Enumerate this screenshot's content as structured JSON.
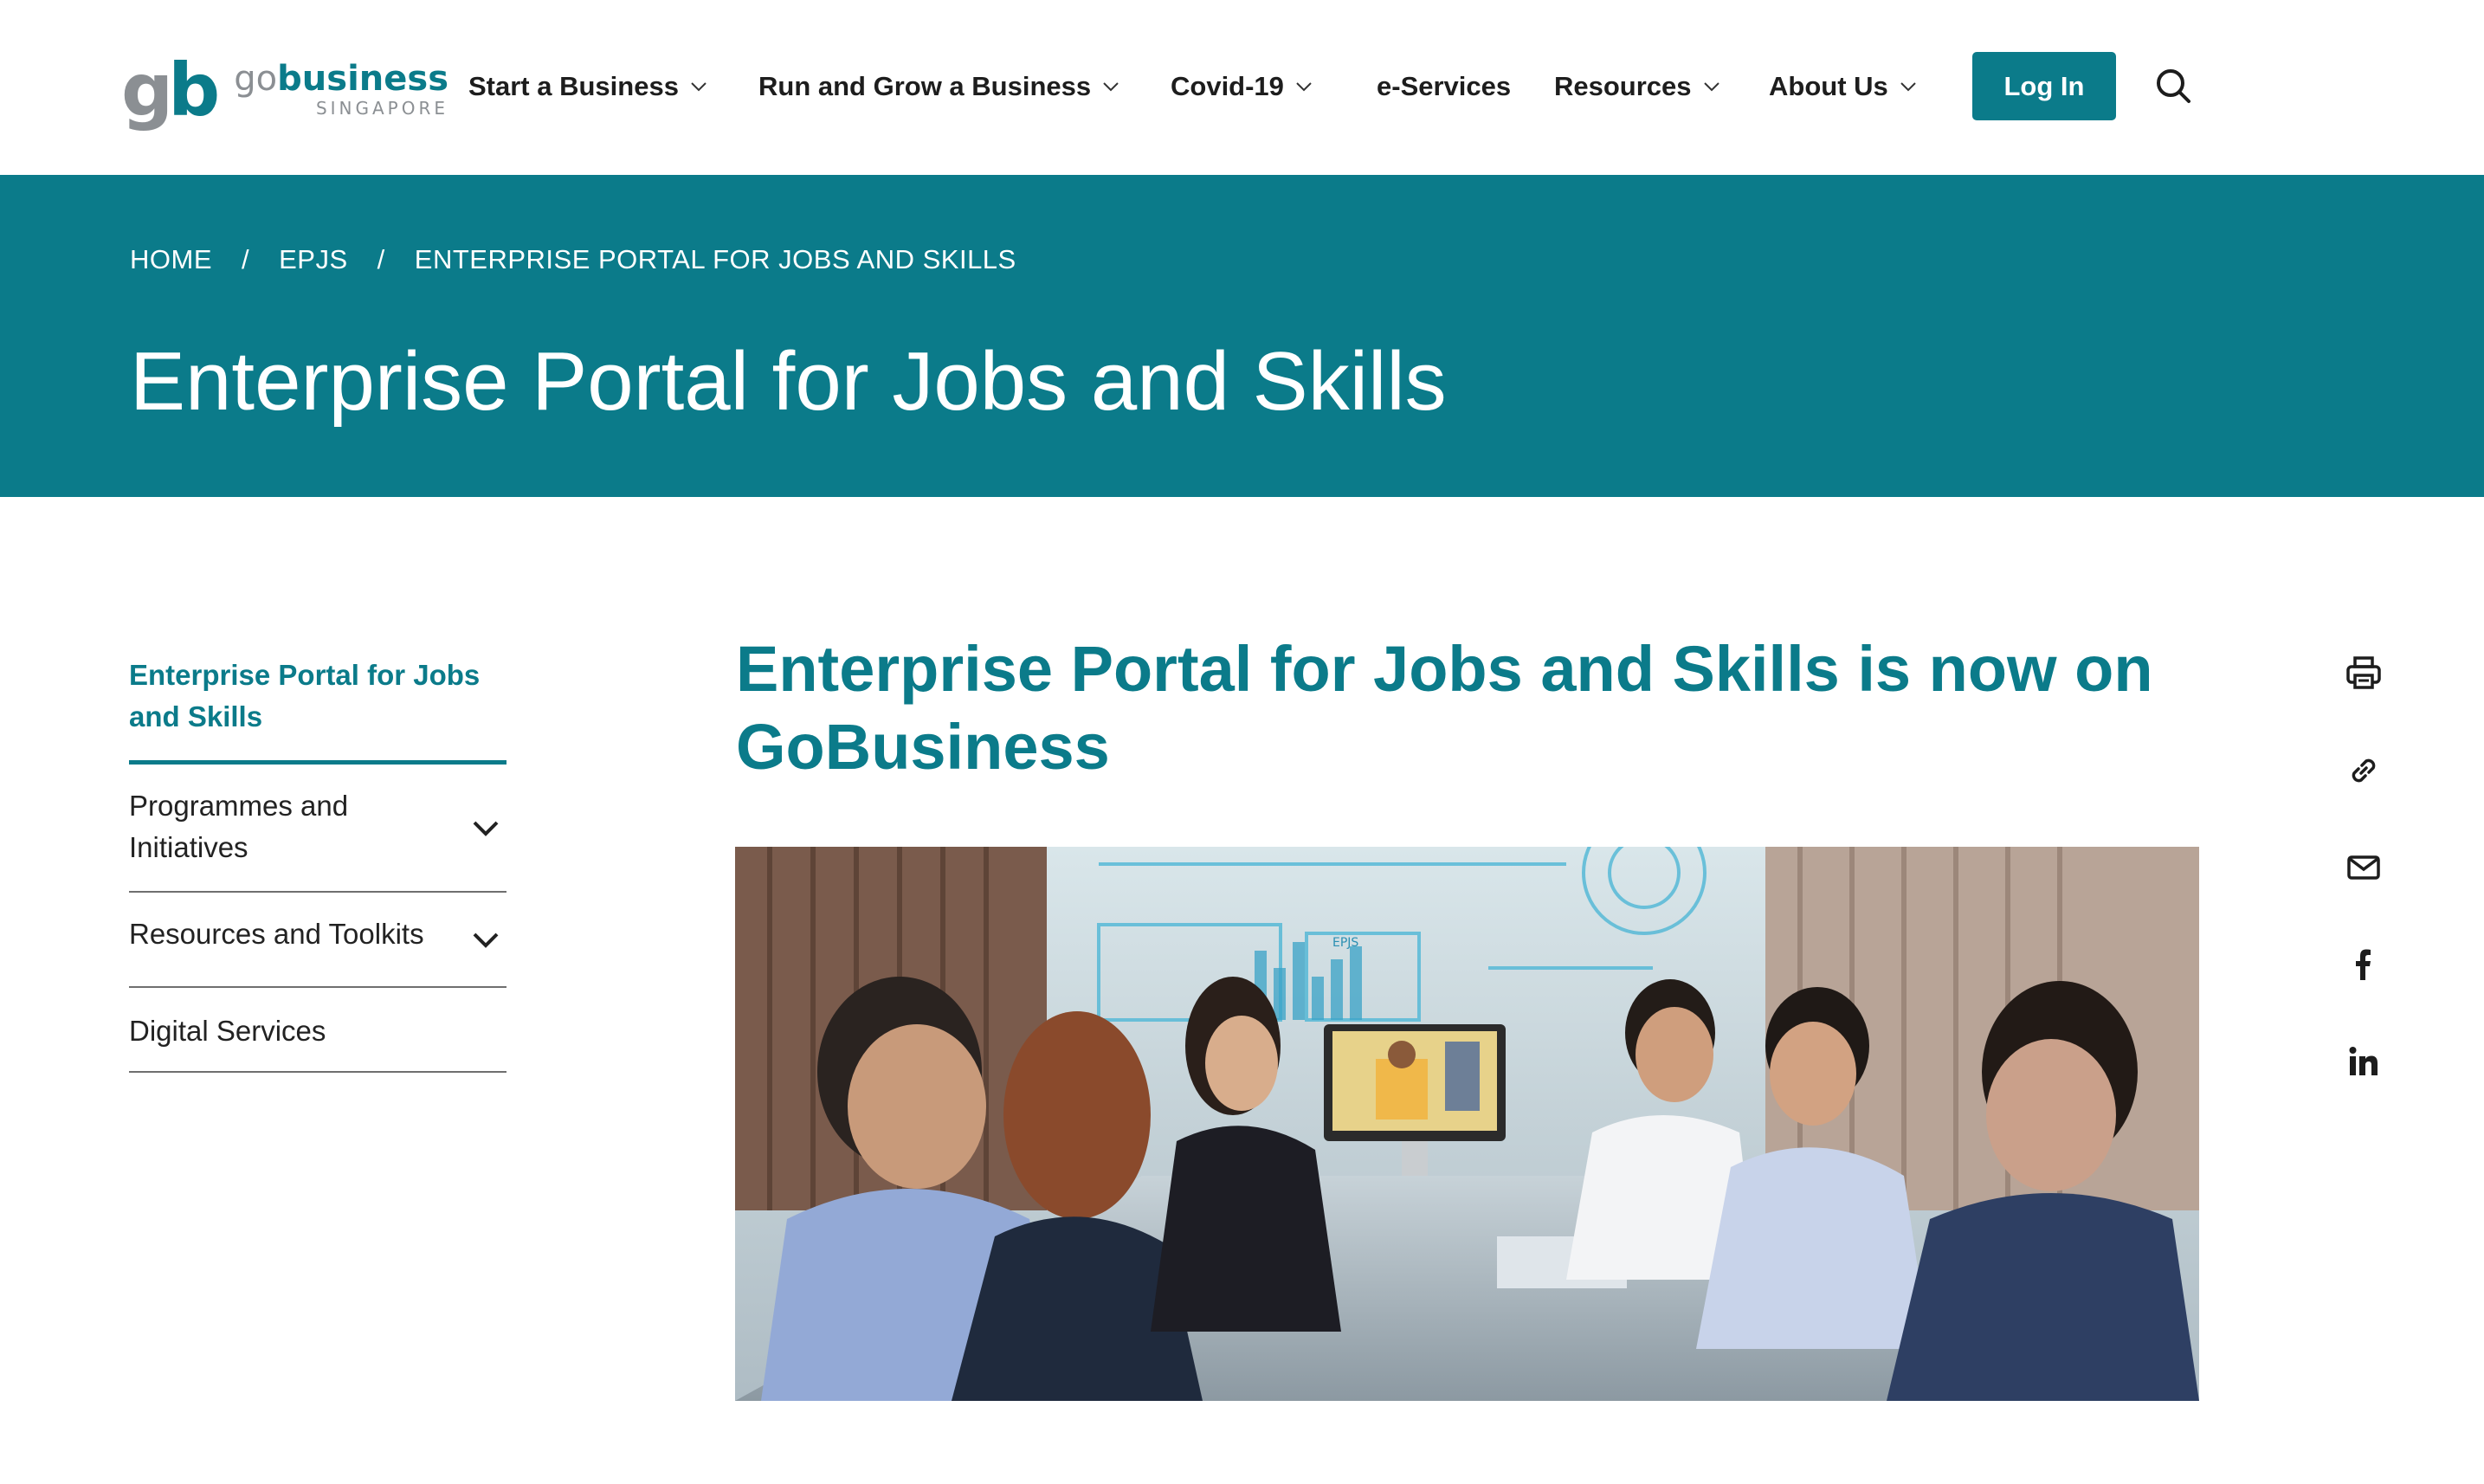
{
  "brand": {
    "mark_g": "g",
    "mark_b": "b",
    "name_go": "go",
    "name_business": "business",
    "tagline": "SINGAPORE",
    "accent_color": "#0b7b8a",
    "grey_color": "#8b8f93"
  },
  "nav": {
    "items": [
      {
        "label": "Start a Business",
        "has_dropdown": true
      },
      {
        "label": "Run and Grow a Business",
        "has_dropdown": true
      },
      {
        "label": "Covid-19",
        "has_dropdown": true
      },
      {
        "label": "e-Services",
        "has_dropdown": false
      },
      {
        "label": "Resources",
        "has_dropdown": true
      },
      {
        "label": "About Us",
        "has_dropdown": true
      }
    ],
    "login_label": "Log In",
    "search_icon": "search-icon"
  },
  "hero": {
    "breadcrumb": [
      "HOME",
      "EPJS",
      "ENTERPRISE PORTAL FOR JOBS AND SKILLS"
    ],
    "separator": "/",
    "title": "Enterprise Portal for Jobs and Skills"
  },
  "sidebar": {
    "active_label": "Enterprise Portal for Jobs and Skills",
    "items": [
      {
        "label": "Programmes and Initiatives",
        "expandable": true
      },
      {
        "label": "Resources and Toolkits",
        "expandable": true
      },
      {
        "label": "Digital Services",
        "expandable": false
      }
    ]
  },
  "main": {
    "heading": "Enterprise Portal for Jobs and Skills is now on GoBusiness",
    "image_icon": "meeting-room-photo",
    "image_screen_text": "EPJS"
  },
  "share": {
    "icons": [
      "print-icon",
      "link-icon",
      "email-icon",
      "facebook-icon",
      "linkedin-icon"
    ]
  }
}
